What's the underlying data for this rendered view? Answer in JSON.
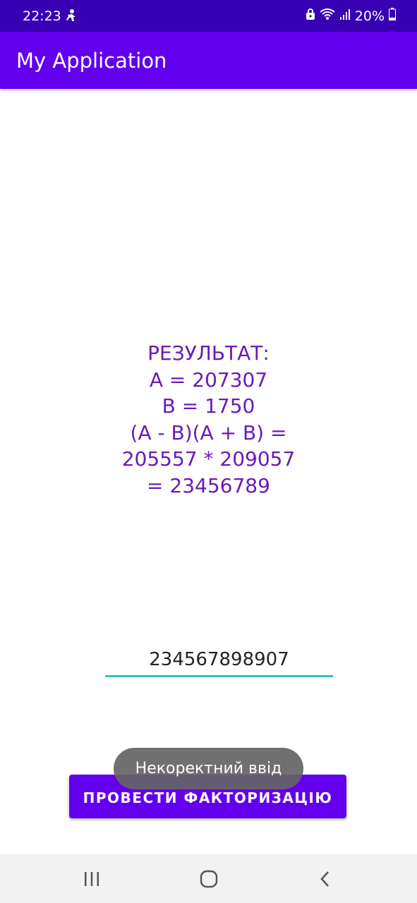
{
  "status_bar": {
    "time": "22:23",
    "battery": "20%",
    "icons": [
      "notification-icon",
      "lock-icon",
      "wifi-icon",
      "signal-icon",
      "battery-icon"
    ]
  },
  "app_bar": {
    "title": "My Application",
    "color": "#6200ee"
  },
  "result": {
    "lines": [
      "РЕЗУЛЬТАТ:",
      "A = 207307",
      "B = 1750",
      "(A - B)(A + B) =",
      "205557 * 209057",
      "= 23456789"
    ],
    "color": "#6a1ab8"
  },
  "input": {
    "value": "234567898907",
    "underline_color": "#26c6bf"
  },
  "button": {
    "label": "ПРОВЕСТИ ФАКТОРИЗАЦІЮ"
  },
  "toast": {
    "message": "Некоректний ввід"
  },
  "nav_bar": {
    "icons": [
      "recent-apps-icon",
      "home-icon",
      "back-icon"
    ]
  }
}
